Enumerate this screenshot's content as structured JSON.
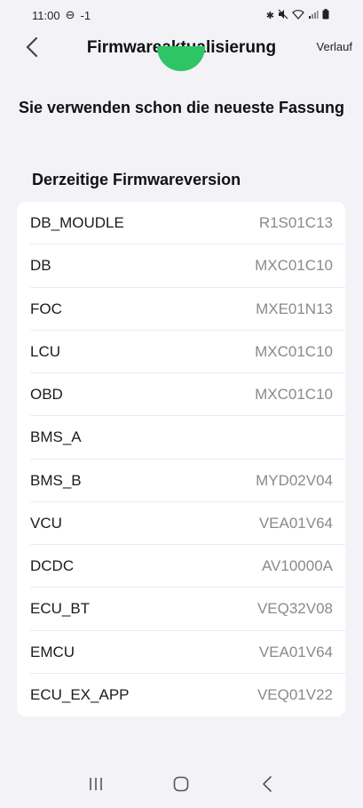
{
  "status": {
    "time": "11:00",
    "extra": "-1"
  },
  "header": {
    "title": "Firmwareaktualisierung",
    "history_label": "Verlauf"
  },
  "message": "Sie verwenden schon die neueste Fassung",
  "section_title": "Derzeitige Firmwareversion",
  "accent_color": "#2dc565",
  "firmware": [
    {
      "name": "DB_MOUDLE",
      "version": "R1S01C13"
    },
    {
      "name": "DB",
      "version": "MXC01C10"
    },
    {
      "name": "FOC",
      "version": "MXE01N13"
    },
    {
      "name": "LCU",
      "version": "MXC01C10"
    },
    {
      "name": "OBD",
      "version": "MXC01C10"
    },
    {
      "name": "BMS_A",
      "version": ""
    },
    {
      "name": "BMS_B",
      "version": "MYD02V04"
    },
    {
      "name": "VCU",
      "version": "VEA01V64"
    },
    {
      "name": "DCDC",
      "version": "AV10000A"
    },
    {
      "name": "ECU_BT",
      "version": "VEQ32V08"
    },
    {
      "name": "EMCU",
      "version": "VEA01V64"
    },
    {
      "name": "ECU_EX_APP",
      "version": "VEQ01V22"
    }
  ]
}
